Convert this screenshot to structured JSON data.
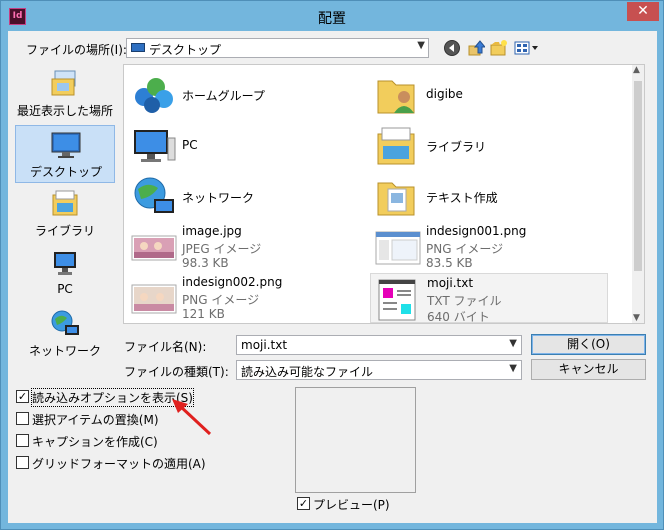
{
  "window": {
    "title": "配置",
    "app_icon": "Id",
    "close": "✕"
  },
  "location": {
    "label": "ファイルの場所(I):",
    "value": "デスクトップ"
  },
  "toolbar": {
    "back": "back-icon",
    "up": "up-folder-icon",
    "new_folder": "new-folder-icon",
    "view": "view-menu-icon"
  },
  "places": [
    {
      "label": "最近表示した場所",
      "icon": "recent-places-icon"
    },
    {
      "label": "デスクトップ",
      "icon": "desktop-icon",
      "selected": true
    },
    {
      "label": "ライブラリ",
      "icon": "libraries-icon"
    },
    {
      "label": "PC",
      "icon": "pc-icon"
    },
    {
      "label": "ネットワーク",
      "icon": "network-icon"
    }
  ],
  "files": [
    {
      "name": "ホームグループ",
      "icon": "homegroup-icon"
    },
    {
      "name": "digibe",
      "icon": "user-folder-icon"
    },
    {
      "name": "PC",
      "icon": "pc-icon"
    },
    {
      "name": "ライブラリ",
      "icon": "libraries-icon"
    },
    {
      "name": "ネットワーク",
      "icon": "network-icon"
    },
    {
      "name": "テキスト作成",
      "icon": "folder-icon"
    },
    {
      "name": "image.jpg",
      "type": "JPEG イメージ",
      "size": "98.3 KB",
      "icon": "image-thumb-icon"
    },
    {
      "name": "indesign001.png",
      "type": "PNG イメージ",
      "size": "83.5 KB",
      "icon": "screenshot-thumb-icon"
    },
    {
      "name": "indesign002.png",
      "type": "PNG イメージ",
      "size": "121 KB",
      "icon": "image-thumb-icon"
    },
    {
      "name": "moji.txt",
      "type": "TXT ファイル",
      "size": "640 バイト",
      "icon": "text-file-icon",
      "selected": true
    }
  ],
  "filename": {
    "label": "ファイル名(N):",
    "value": "moji.txt"
  },
  "filetype": {
    "label": "ファイルの種類(T):",
    "value": "読み込み可能なファイル"
  },
  "buttons": {
    "open": "開く(O)",
    "cancel": "キャンセル"
  },
  "options": [
    {
      "label": "読み込みオプションを表示(S)",
      "checked": true
    },
    {
      "label": "選択アイテムの置換(M)",
      "checked": false
    },
    {
      "label": "キャプションを作成(C)",
      "checked": false
    },
    {
      "label": "グリッドフォーマットの適用(A)",
      "checked": false
    }
  ],
  "preview": {
    "label": "プレビュー(P)",
    "checked": true
  },
  "colors": {
    "accent": "#c9e0f7",
    "titlebar": "#73b6dd",
    "close": "#c75050",
    "annotation_arrow": "#e0201e"
  }
}
